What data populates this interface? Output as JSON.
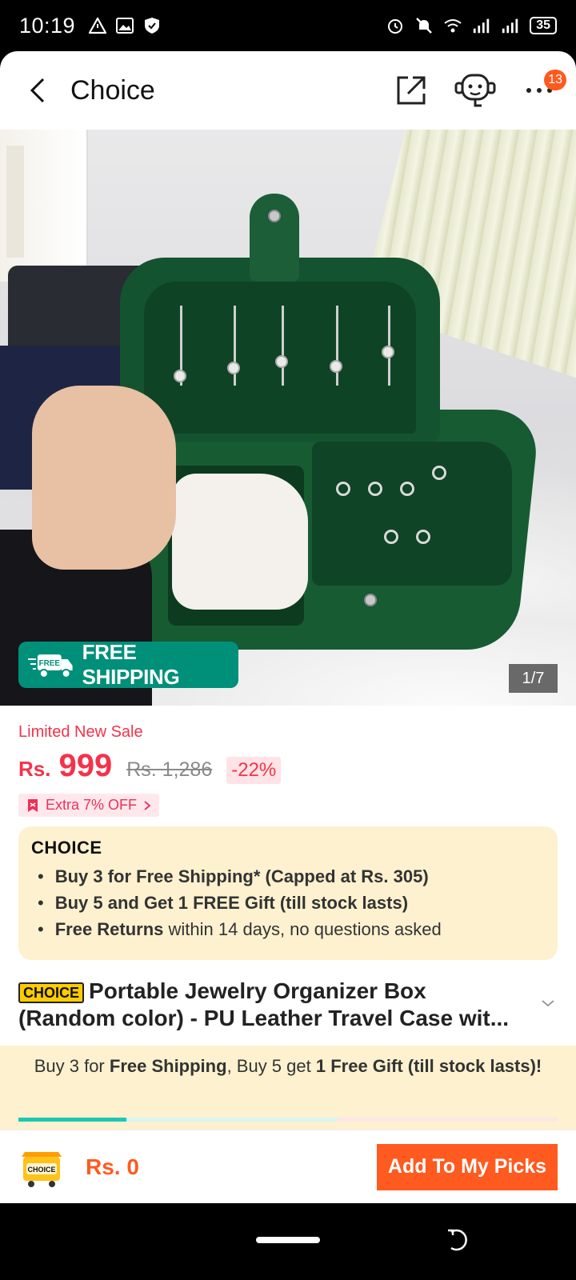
{
  "status_bar": {
    "time": "10:19",
    "battery": "35",
    "left_icons": [
      "warning-icon",
      "image-icon",
      "shield-icon"
    ],
    "right_icons": [
      "alarm-icon",
      "mute-icon",
      "wifi-icon",
      "signal-icon",
      "signal-icon",
      "battery-icon"
    ]
  },
  "header": {
    "title": "Choice",
    "notification_count": "13"
  },
  "gallery": {
    "counter": "1/7",
    "free_shipping_label": "FREE SHIPPING",
    "free_shipping_icon_text": "FREE"
  },
  "pricing": {
    "sale_label": "Limited New Sale",
    "currency": "Rs.",
    "price": "999",
    "original_price": "Rs. 1,286",
    "discount": "-22%",
    "coupon": "Extra 7% OFF"
  },
  "choice_card": {
    "logo": "CHOICE",
    "items": [
      {
        "bold": "Buy 3 for  Free Shipping* (Capped at Rs. 305)",
        "rest": ""
      },
      {
        "bold": "Buy 5 and Get 1 FREE Gift (till stock lasts)",
        "rest": ""
      },
      {
        "bold": "Free Returns",
        "rest": " within 14 days, no questions asked"
      }
    ]
  },
  "product": {
    "tag": "CHOICE",
    "title_line1": "Portable Jewelry Organizer Box",
    "title_line2": "(Random color) - PU Leather Travel Case wit..."
  },
  "promo": {
    "p1": "Buy 3 for ",
    "b1": "Free Shipping",
    "p2": ", Buy 5 get ",
    "b2": "1 Free Gift (till stock lasts)!",
    "progress_fraction": 0.2
  },
  "bottom_bar": {
    "cart_label": "CHOICE",
    "total": "Rs. 0",
    "button": "Add To My Picks"
  },
  "colors": {
    "accent_orange": "#ff5a1f",
    "price_red": "#f5324a",
    "shipping_green": "#00907a",
    "choice_bg": "#fdf1cf"
  }
}
